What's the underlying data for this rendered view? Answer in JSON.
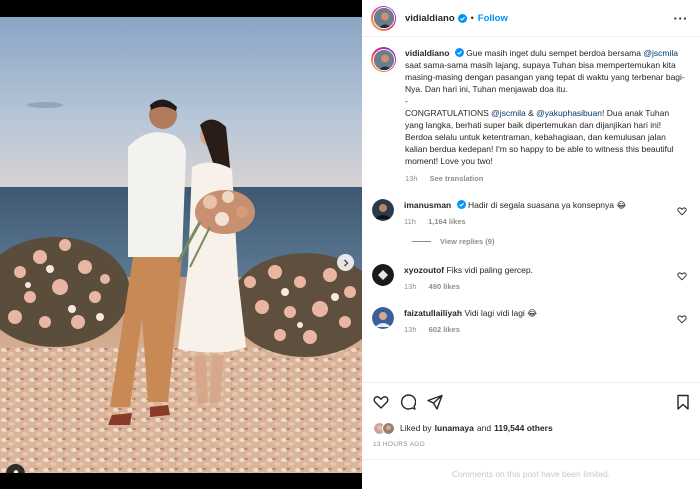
{
  "post": {
    "username": "vidialdiano",
    "follow_label": "Follow",
    "separator": "•",
    "more_label": "···"
  },
  "caption": {
    "username": "vidialdiano",
    "part1": "Gue masih inget dulu sempet berdoa bersama",
    "mention1": "@jscmila",
    "part2": "saat sama-sama masih lajang, supaya Tuhan bisa mempertemukan kita masing-masing dengan pasangan yang tepat di waktu yang terbenar bagi-Nya. Dan hari ini, Tuhan menjawab doa itu.",
    "dash": "-",
    "part3": "CONGRATULATIONS",
    "mention2": "@jscmila",
    "amp": "&",
    "mention3": "@yakuphasibuan",
    "part4": "! Dua anak Tuhan yang langka, berhati super baik dipertemukan dan dijanjikan hari ini! Berdoa selalu untuk ketentraman, kebahagiaan, dan kemulusan jalan kalian berdua kedepan! I'm so happy to be able to witness this beautiful moment! Love you two!",
    "time": "13h",
    "see_translation": "See translation"
  },
  "comments": [
    {
      "username": "imanusman",
      "text": "Hadir di segala suasana ya konsepnya 😂",
      "time": "11h",
      "likes": "1,164 likes",
      "view_replies": "View replies (9)",
      "avatar_color": "#2b3a4a"
    },
    {
      "username": "xyozoutof",
      "text": "Fiks vidi paling gercep.",
      "time": "13h",
      "likes": "490 likes",
      "avatar_color": "#1a1a1a"
    },
    {
      "username": "faizatullailiyah",
      "text": "Vidi lagi vidi lagi 😂",
      "time": "13h",
      "likes": "602 likes",
      "avatar_color": "#3b5f9a"
    }
  ],
  "likes": {
    "prefix": "Liked by",
    "user": "lunamaya",
    "and": "and",
    "others": "119,544 others"
  },
  "timestamp": "13 HOURS AGO",
  "comments_limited": "Comments on this post have been limited.",
  "colors": {
    "accent": "#0095f6",
    "verified": "#0095f6",
    "mention": "#00376b",
    "muted": "#8e8e8e"
  },
  "icons": [
    "verified-icon",
    "heart-icon",
    "comment-icon",
    "share-icon",
    "bookmark-icon",
    "chevron-right-icon",
    "user-tag-icon",
    "more-icon"
  ]
}
